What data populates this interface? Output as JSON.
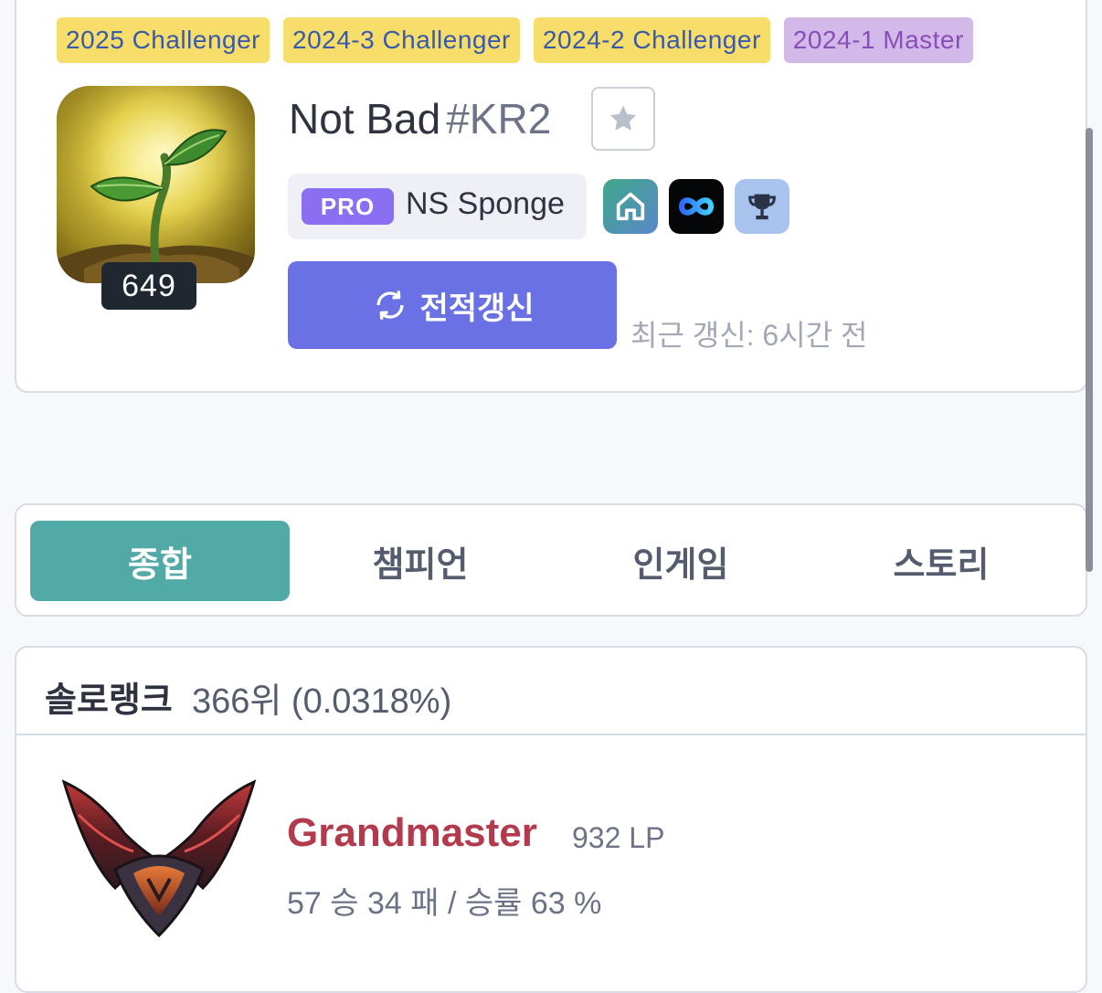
{
  "profile": {
    "seasons": [
      {
        "label": "2025  Challenger",
        "color": "gold"
      },
      {
        "label": "2024-3  Challenger",
        "color": "gold"
      },
      {
        "label": "2024-2  Challenger",
        "color": "gold"
      },
      {
        "label": "2024-1  Master",
        "color": "purple"
      }
    ],
    "level": "649",
    "name": "Not Bad",
    "tag": "#KR2",
    "pro_badge": "PRO",
    "pro_name": "NS Sponge",
    "refresh_label": "전적갱신",
    "last_update": "최근 갱신: 6시간 전",
    "icons": {
      "favorite": "star-icon",
      "home": "home-icon",
      "infinity": "infinity-icon",
      "trophy": "trophy-icon",
      "refresh": "refresh-icon",
      "avatar": "sprout-profile-icon"
    },
    "colors": {
      "accent": "#6a71e4",
      "tab_active": "#52aaa6",
      "tier": "#b33a4c",
      "pro": "#8a6ff2"
    }
  },
  "tabs": [
    {
      "label": "종합",
      "active": true
    },
    {
      "label": "챔피언",
      "active": false
    },
    {
      "label": "인게임",
      "active": false
    },
    {
      "label": "스토리",
      "active": false
    }
  ],
  "rank": {
    "queue": "솔로랭크",
    "ladder": "366위 (0.0318%)",
    "tier": "Grandmaster",
    "lp": "932 LP",
    "record": "57 승 34 패 / 승률 63 %"
  }
}
